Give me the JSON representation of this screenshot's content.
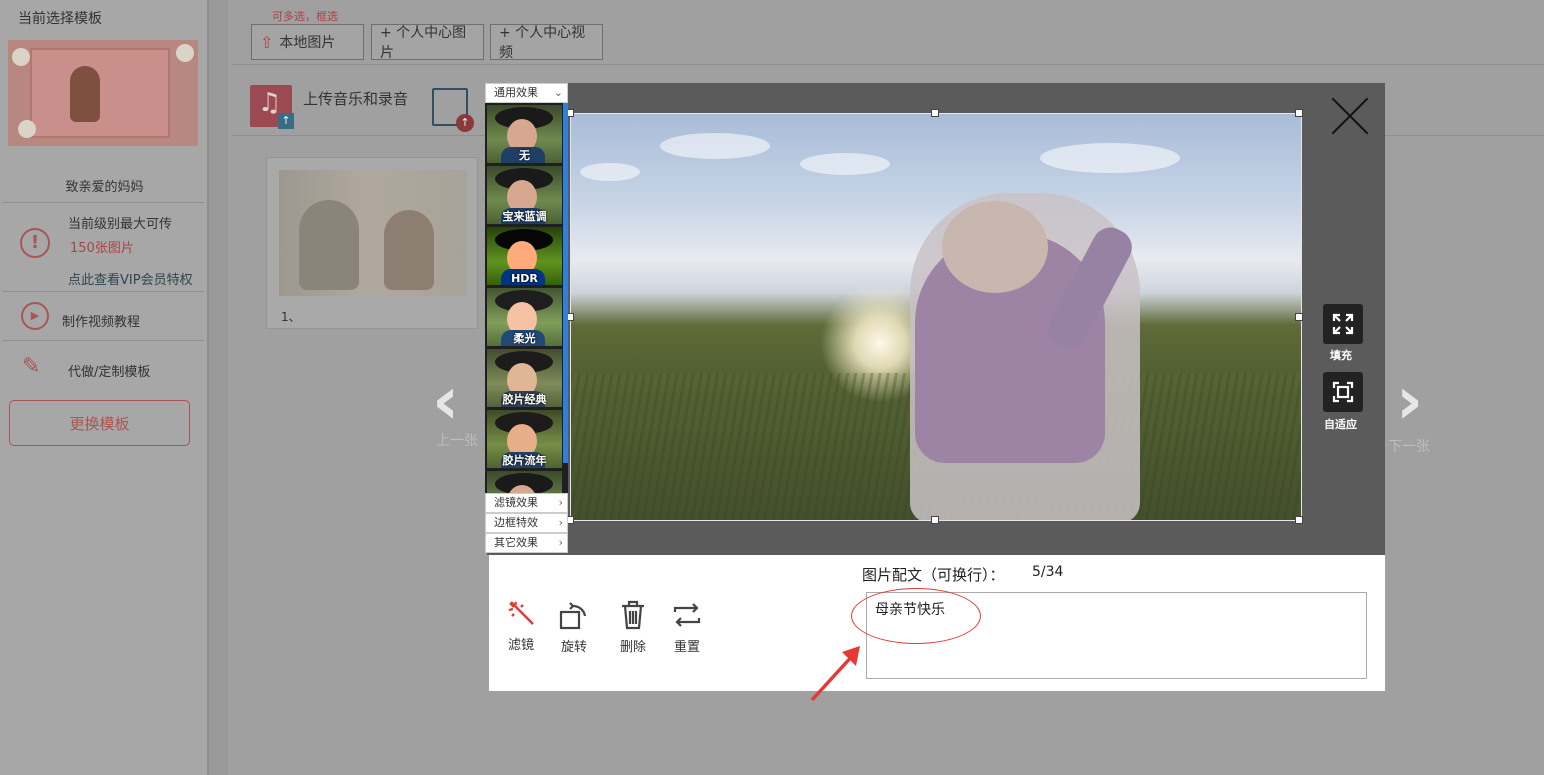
{
  "sidebar": {
    "title": "当前选择模板",
    "template_name": "致亲爱的妈妈",
    "level_line1": "当前级别最大可传",
    "level_count": "150张图片",
    "vip_link": "点此查看VIP会员特权",
    "tutorial": "制作视频教程",
    "custom": "代做/定制模板",
    "change_button": "更换模板"
  },
  "toolbar": {
    "hint": "可多选，框选",
    "local_image": "本地图片",
    "personal_images": "+ 个人中心图片",
    "personal_videos": "+ 个人中心视频"
  },
  "upload": {
    "music": "上传音乐和录音"
  },
  "photo_card": {
    "caption": "1、"
  },
  "editor": {
    "filter_header": "通用效果",
    "filters": [
      "无",
      "宝来蓝调",
      "HDR",
      "柔光",
      "胶片经典",
      "胶片流年",
      ""
    ],
    "menus": [
      "滤镜效果",
      "边框特效",
      "其它效果"
    ],
    "fill_label": "填充",
    "fit_label": "自适应",
    "prev_label": "上一张",
    "next_label": "下一张",
    "tools": {
      "filter": "滤镜",
      "rotate": "旋转",
      "delete": "删除",
      "reset": "重置"
    },
    "caption_label": "图片配文（可换行）：",
    "caption_count": "5/34",
    "caption_value": "母亲节快乐"
  },
  "colors": {
    "accent_red": "#e53935",
    "modal_dark": "#5b5b5b",
    "filter_scroll": "#2f7fdb"
  }
}
